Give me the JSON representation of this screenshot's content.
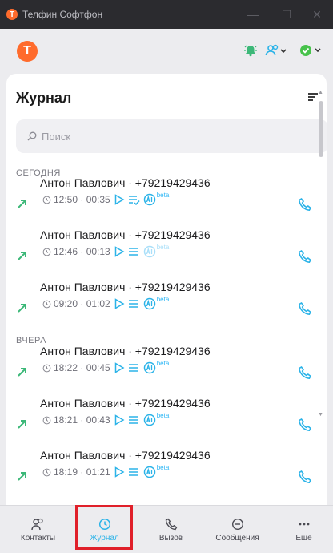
{
  "window": {
    "title": "Телфин Софтфон",
    "app_initial": "T"
  },
  "header": {
    "avatar_initial": "T"
  },
  "panel": {
    "title": "Журнал",
    "search_placeholder": "Поиск"
  },
  "sections": [
    {
      "label": "СЕГОДНЯ"
    },
    {
      "label": "ВЧЕРА"
    }
  ],
  "calls": [
    {
      "name": "Антон Павлович · +79219429436",
      "time": "12:50",
      "duration": "00:35",
      "beta": "beta",
      "ai_dim": false,
      "transcript_checked": true
    },
    {
      "name": "Антон Павлович · +79219429436",
      "time": "12:46",
      "duration": "00:13",
      "beta": "beta",
      "ai_dim": true,
      "transcript_checked": false
    },
    {
      "name": "Антон Павлович · +79219429436",
      "time": "09:20",
      "duration": "01:02",
      "beta": "beta",
      "ai_dim": false,
      "transcript_checked": false
    },
    {
      "name": "Антон Павлович · +79219429436",
      "time": "18:22",
      "duration": "00:45",
      "beta": "beta",
      "ai_dim": false,
      "transcript_checked": false
    },
    {
      "name": "Антон Павлович · +79219429436",
      "time": "18:21",
      "duration": "00:43",
      "beta": "beta",
      "ai_dim": false,
      "transcript_checked": false
    },
    {
      "name": "Антон Павлович · +79219429436",
      "time": "18:19",
      "duration": "01:21",
      "beta": "beta",
      "ai_dim": false,
      "transcript_checked": false
    }
  ],
  "nav": {
    "contacts": "Контакты",
    "journal": "Журнал",
    "call": "Вызов",
    "messages": "Сообщения",
    "more": "Еще"
  },
  "colors": {
    "accent": "#2bb3e8",
    "brand": "#ff6b2c",
    "outgoing_arrow": "#3cb878",
    "status_ok": "#47c24b",
    "highlight": "#e0202a"
  },
  "icons": {
    "outgoing": "outgoing-call-arrow-icon",
    "play": "play-icon",
    "transcript": "transcript-icon",
    "ai": "ai-summary-icon",
    "phone": "phone-icon"
  }
}
